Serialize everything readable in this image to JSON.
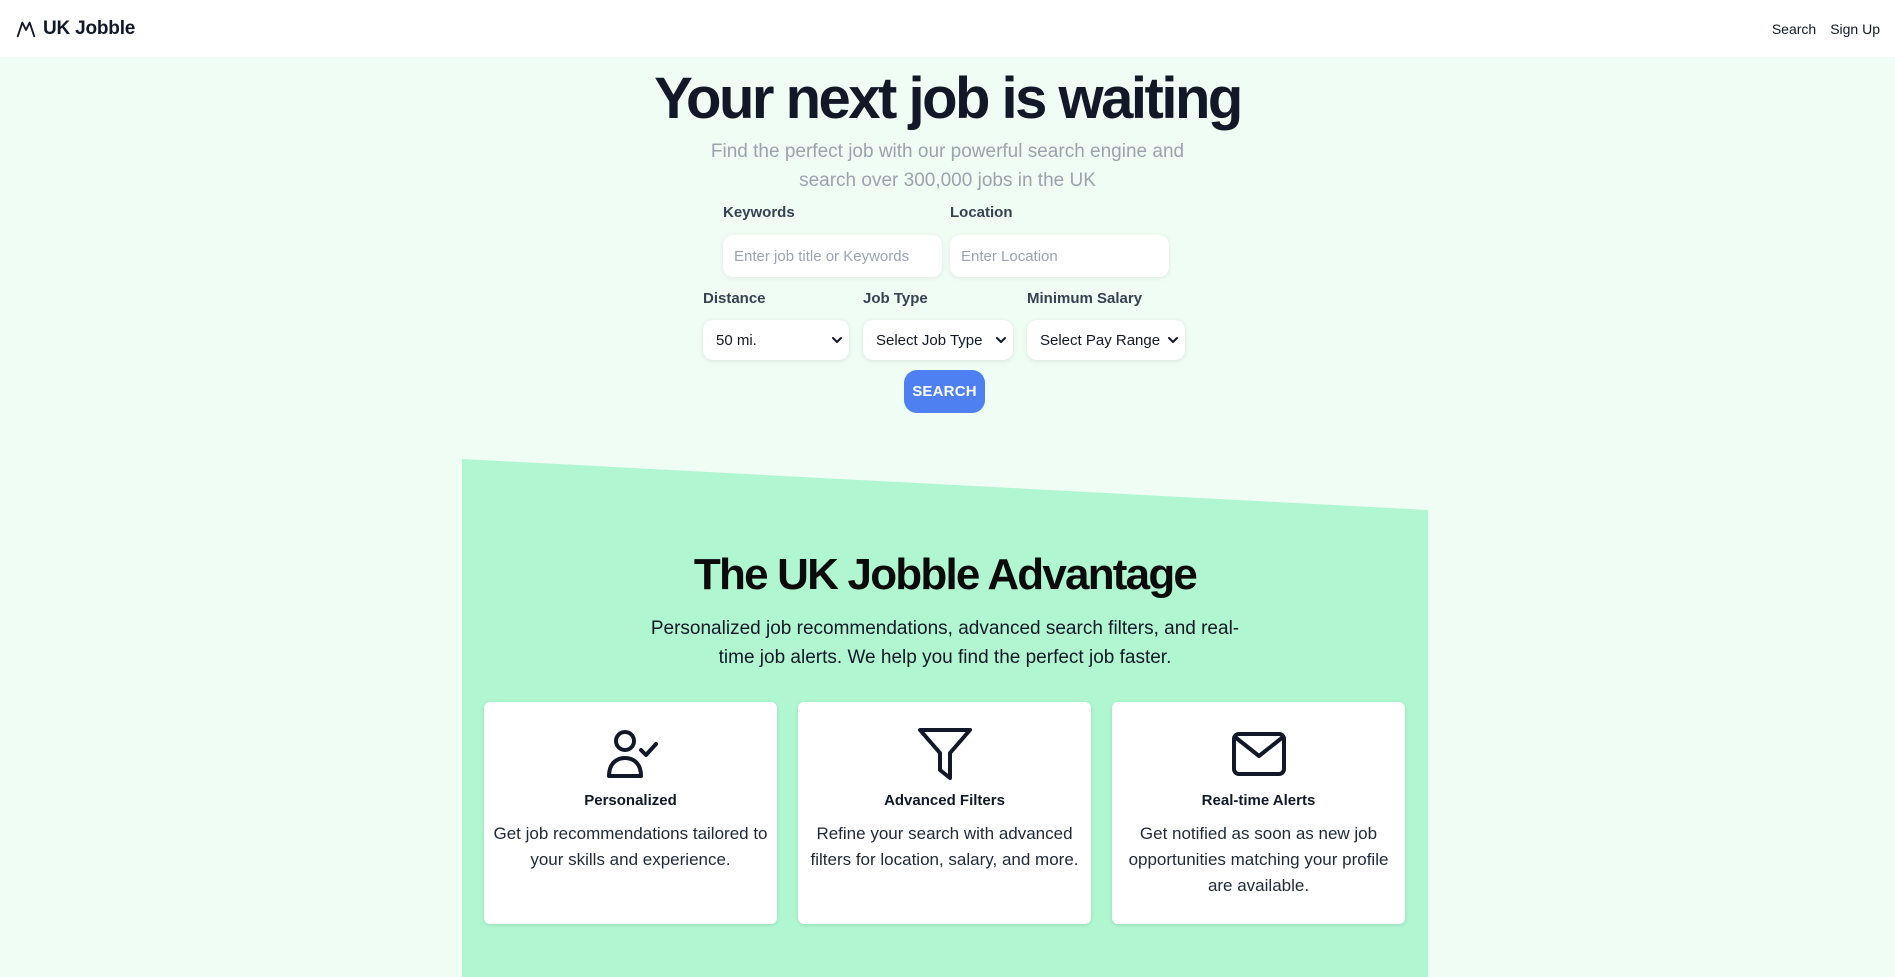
{
  "nav": {
    "brand": "UK Jobble",
    "brand_icon": "mountain-logo-icon",
    "links": [
      "Search",
      "Sign Up"
    ]
  },
  "hero": {
    "title": "Your next job is waiting",
    "subtitle": "Find the perfect job with our powerful search engine and search over 300,000 jobs in the UK"
  },
  "search_form": {
    "keywords_label": "Keywords",
    "keywords_placeholder": "Enter job title or Keywords",
    "location_label": "Location",
    "location_placeholder": "Enter Location",
    "distance_label": "Distance",
    "distance_value": "50 mi.",
    "job_type_label": "Job Type",
    "job_type_value": "Select Job Type",
    "salary_label": "Minimum Salary",
    "salary_value": "Select Pay Range",
    "submit_label": "SEARCH"
  },
  "advantage": {
    "title": "The UK Jobble Advantage",
    "subtitle": "Personalized job recommendations, advanced search filters, and real-time job alerts. We help you find the perfect job faster.",
    "cards": [
      {
        "icon": "user-check-icon",
        "title": "Personalized",
        "text": "Get job recommendations tailored to your skills and experience."
      },
      {
        "icon": "filter-icon",
        "title": "Advanced Filters",
        "text": "Refine your search with advanced filters for location, salary, and more."
      },
      {
        "icon": "mail-icon",
        "title": "Real-time Alerts",
        "text": "Get notified as soon as new job opportunities matching your profile are available."
      }
    ]
  },
  "colors": {
    "page_bg": "#f0fdf4",
    "advantage_bg": "#b0f7d1",
    "accent": "#4f80f1"
  }
}
